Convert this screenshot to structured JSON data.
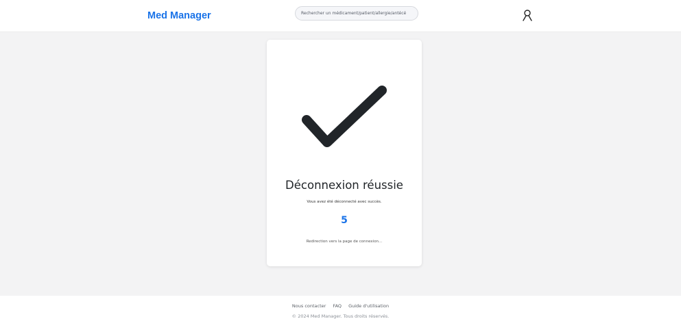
{
  "header": {
    "logo": "Med Manager",
    "search_placeholder": "Rechercher un médicament/patient/allergie/antécé",
    "user_icon": "user-icon"
  },
  "card": {
    "icon": "checkmark-icon",
    "title": "Déconnexion réussie",
    "subtitle": "Vous avez été déconnecté avec succès.",
    "countdown": "5",
    "redirect_text": "Redirection vers la page de connexion..."
  },
  "footer": {
    "links": [
      "Nous contacter",
      "FAQ",
      "Guide d'utilisation"
    ],
    "copyright": "© 2024 Med Manager. Tous droits réservés."
  },
  "colors": {
    "brand": "#1a73e8",
    "background": "#f3f3f4",
    "checkmark": "#212529"
  }
}
